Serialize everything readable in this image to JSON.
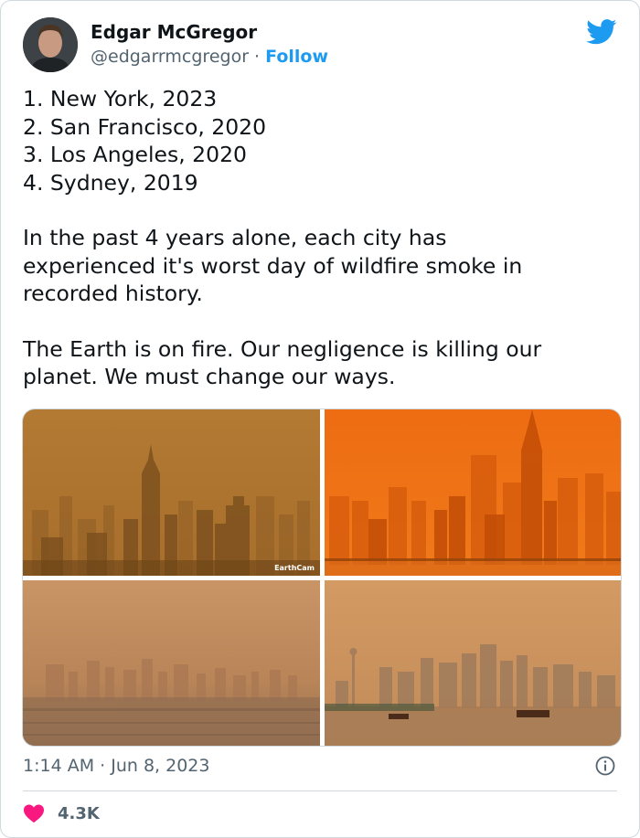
{
  "author": {
    "name": "Edgar McGregor",
    "handle": "@edgarrmcgregor",
    "separator": " · ",
    "follow_label": "Follow"
  },
  "tweet": {
    "list": [
      "1. New York, 2023",
      "2. San Francisco, 2020",
      "3. Los Angeles, 2020",
      "4. Sydney, 2019"
    ],
    "para1": [
      "In the past 4 years alone, each city has",
      "experienced it's worst day of wildfire smoke in",
      "recorded history."
    ],
    "para2": [
      "The Earth is on fire. Our negligence is killing our",
      "planet. We must change our ways."
    ]
  },
  "media": {
    "watermark": "EarthCam"
  },
  "meta": {
    "timestamp": "1:14 AM · Jun 8, 2023",
    "likes": "4.3K"
  },
  "icons": [
    "twitter-bird-icon",
    "info-icon",
    "heart-icon"
  ],
  "colors": {
    "accent": "#1d9bf0",
    "text": "#0f1419",
    "secondary": "#536471",
    "heart": "#f91880"
  }
}
